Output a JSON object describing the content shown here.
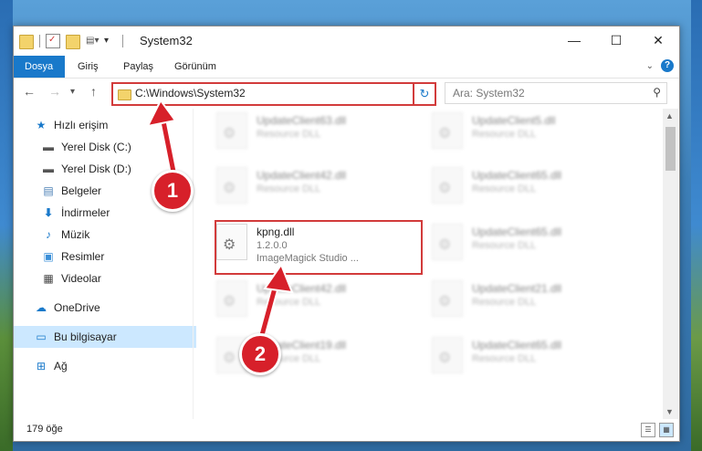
{
  "window": {
    "title": "System32",
    "minimize": "—",
    "maximize": "☐",
    "close": "✕"
  },
  "ribbon": {
    "tabs": [
      "Dosya",
      "Giriş",
      "Paylaş",
      "Görünüm"
    ],
    "help": "?"
  },
  "navigation": {
    "back": "←",
    "forward": "→",
    "recent": "▾",
    "up": "↑",
    "address": "C:\\Windows\\System32",
    "refresh": "↻",
    "search_placeholder": "Ara: System32"
  },
  "sidebar": {
    "items": [
      {
        "label": "Hızlı erişim",
        "icon": "star-icon",
        "pinned": false
      },
      {
        "label": "Yerel Disk (C:)",
        "icon": "drive-icon",
        "pinned": true
      },
      {
        "label": "Yerel Disk (D:)",
        "icon": "drive-icon",
        "pinned": true
      },
      {
        "label": "Belgeler",
        "icon": "documents-icon",
        "pinned": true
      },
      {
        "label": "İndirmeler",
        "icon": "download-icon",
        "pinned": true
      },
      {
        "label": "Müzik",
        "icon": "music-icon",
        "pinned": true
      },
      {
        "label": "Resimler",
        "icon": "pictures-icon",
        "pinned": true
      },
      {
        "label": "Videolar",
        "icon": "videos-icon",
        "pinned": true
      },
      {
        "label": "OneDrive",
        "icon": "cloud-icon",
        "pinned": false
      },
      {
        "label": "Bu bilgisayar",
        "icon": "computer-icon",
        "pinned": false,
        "selected": true
      },
      {
        "label": "Ağ",
        "icon": "network-icon",
        "pinned": false
      }
    ]
  },
  "files": [
    {
      "name": "UpdateClient63.dll",
      "type": "Resource DLL"
    },
    {
      "name": "UpdateClient5.dll",
      "type": "Resource DLL"
    },
    {
      "name": "UpdateClient42.dll",
      "type": "Resource DLL"
    },
    {
      "name": "UpdateClient65.dll",
      "type": "Resource DLL"
    },
    {
      "name": "kpng.dll",
      "version": "1.2.0.0",
      "company": "ImageMagick Studio ...",
      "highlighted": true
    },
    {
      "name": "UpdateClient65.dll",
      "type": "Resource DLL"
    },
    {
      "name": "UpdateClient42.dll",
      "type": "Resource DLL"
    },
    {
      "name": "UpdateClient21.dll",
      "type": "Resource DLL"
    },
    {
      "name": "UpdateClient19.dll",
      "type": "Resource DLL"
    },
    {
      "name": "UpdateClient65.dll",
      "type": "Resource DLL"
    }
  ],
  "status": {
    "count": "179 öğe"
  },
  "annotations": [
    "1",
    "2"
  ],
  "colors": {
    "accent": "#1979ca",
    "highlight_border": "#d23b3b",
    "annotation": "#d7202a",
    "selected_bg": "#cce8ff"
  }
}
